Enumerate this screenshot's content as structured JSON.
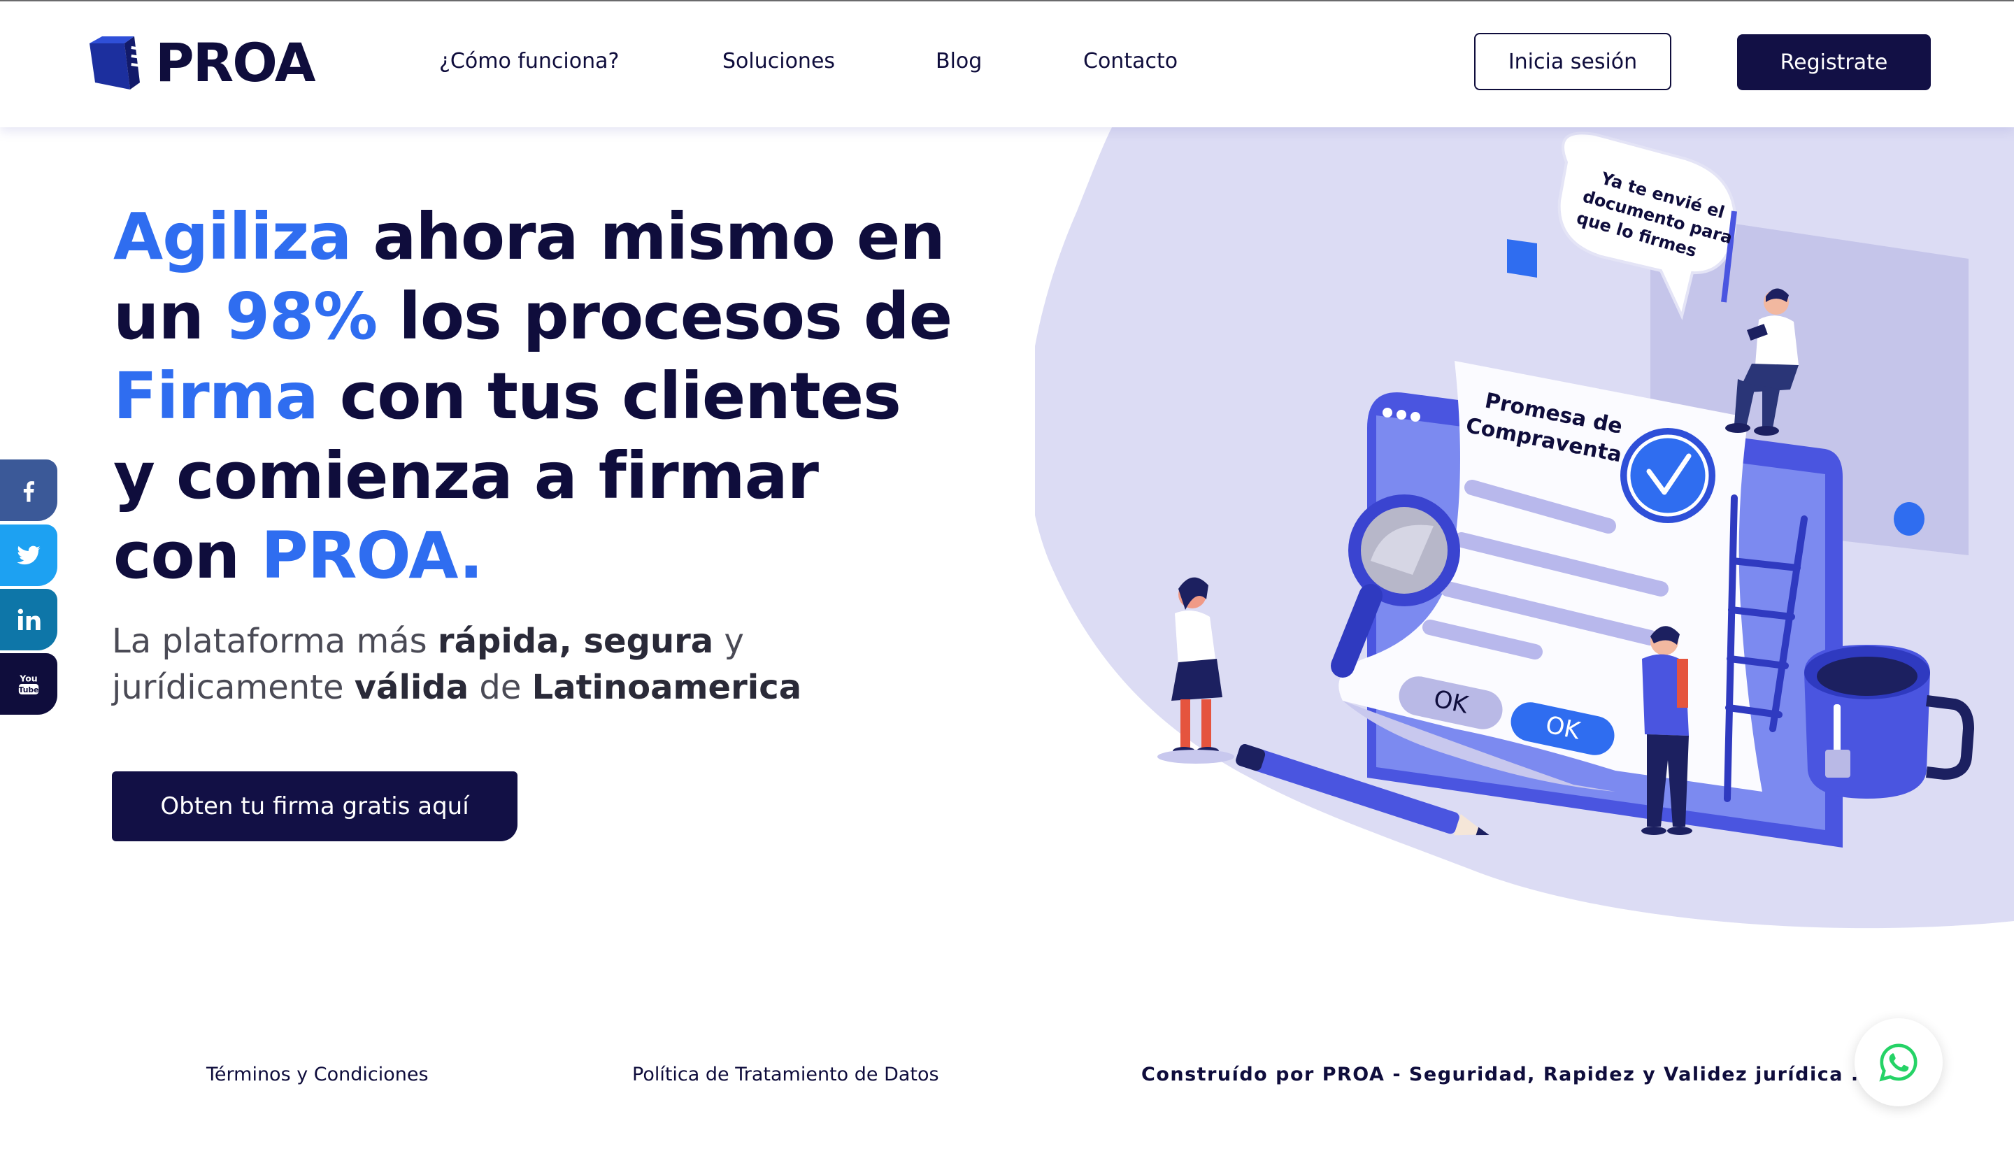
{
  "brand": {
    "name": "PROA"
  },
  "nav": {
    "items": [
      {
        "label": "¿Cómo funciona?"
      },
      {
        "label": "Soluciones"
      },
      {
        "label": "Blog"
      },
      {
        "label": "Contacto"
      }
    ],
    "login_label": "Inicia sesión",
    "register_label": "Registrate"
  },
  "hero": {
    "title": {
      "l1_accent": "Agiliza",
      "l1_rest": " ahora mismo en",
      "l2_pre": "un ",
      "l2_accent": "98%",
      "l2_rest": " los procesos de",
      "l3_accent": "Firma",
      "l3_rest": " con tus clientes",
      "l4": "y comienza a firmar",
      "l5_pre": "con",
      "l5_accent": "PROA."
    },
    "subtitle": {
      "p1": "La plataforma más ",
      "b1": "rápida, segura",
      "p2": " y",
      "p3": "jurídicamente ",
      "b2": "válida",
      "p4": " de ",
      "b3": "Latinoamerica"
    },
    "cta_label": "Obten tu firma gratis aquí"
  },
  "illustration": {
    "speech_bubble": [
      "Ya te envié el",
      "documento para",
      "que lo firmes"
    ],
    "document_title": [
      "Promesa de",
      "Compraventa"
    ],
    "ok_labels": [
      "OK",
      "OK"
    ]
  },
  "social": [
    {
      "name": "facebook-icon",
      "color": "#3b5998"
    },
    {
      "name": "twitter-icon",
      "color": "#1da1f2"
    },
    {
      "name": "linkedin-icon",
      "color": "#0e76a8"
    },
    {
      "name": "youtube-icon",
      "color": "#0f0d3c"
    }
  ],
  "footer": {
    "terms": "Términos y Condiciones",
    "privacy": "Política de Tratamiento de Datos",
    "built": "Construído por PROA - Seguridad, Rapidez y Validez jurídica ."
  },
  "colors": {
    "navy": "#0f0d3c",
    "accent_blue": "#2f6df0",
    "lavender_bg": "#dcdcf4",
    "whatsapp_green": "#25d366"
  }
}
